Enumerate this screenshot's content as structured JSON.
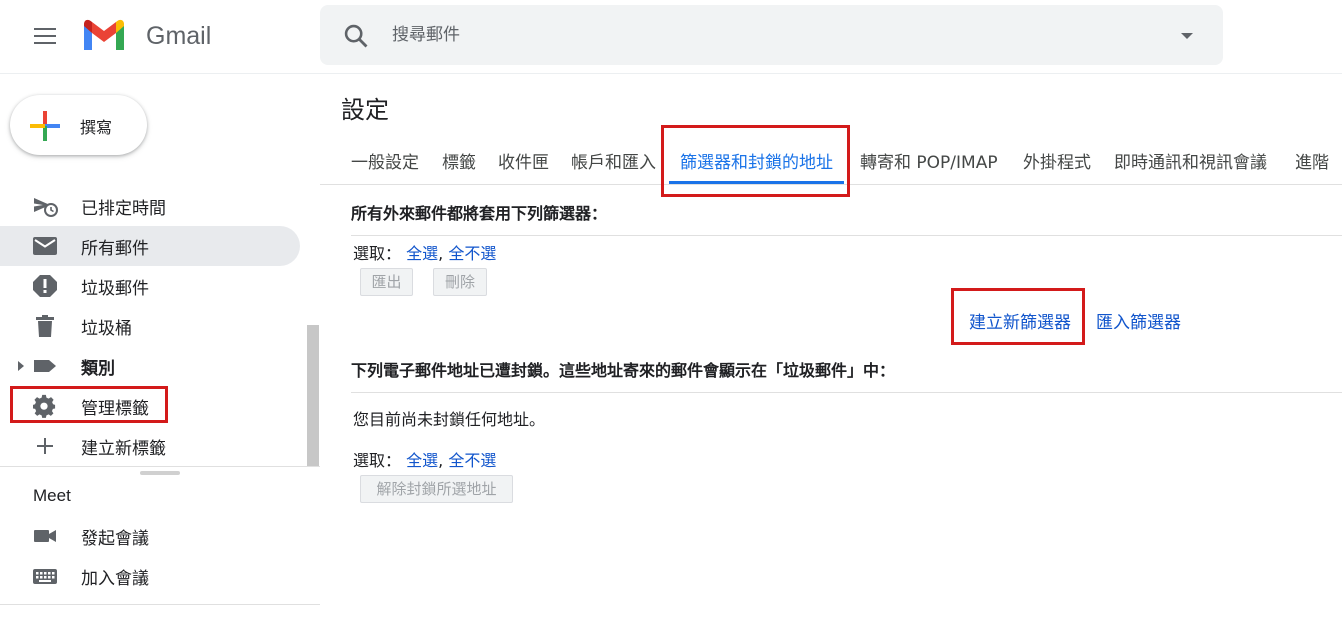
{
  "app": {
    "name": "Gmail",
    "brand_colors": {
      "red": "#ea4335",
      "blue": "#4285f4",
      "yellow": "#fbbc04",
      "green": "#34a853",
      "link": "#1155cc",
      "accent": "#1a73e8",
      "highlight": "#d31a1a"
    }
  },
  "header": {
    "menu_icon": "hamburger-menu-icon",
    "logo_text": "Gmail",
    "search": {
      "placeholder": "搜尋郵件",
      "value": "",
      "icon": "search-icon",
      "options_icon": "caret-down-icon"
    }
  },
  "sidebar": {
    "compose_label": "撰寫",
    "items": [
      {
        "label": "已排定時間",
        "icon": "scheduled-send-icon",
        "active": false
      },
      {
        "label": "所有郵件",
        "icon": "mail-icon",
        "active": true
      },
      {
        "label": "垃圾郵件",
        "icon": "spam-icon",
        "active": false
      },
      {
        "label": "垃圾桶",
        "icon": "trash-icon",
        "active": false
      },
      {
        "label": "類別",
        "icon": "label-icon",
        "active": false,
        "bold": true,
        "expandable": true
      },
      {
        "label": "管理標籤",
        "icon": "gear-icon",
        "active": false,
        "highlighted": true
      },
      {
        "label": "建立新標籤",
        "icon": "plus-icon",
        "active": false
      }
    ],
    "meet": {
      "title": "Meet",
      "items": [
        {
          "label": "發起會議",
          "icon": "video-camera-icon"
        },
        {
          "label": "加入會議",
          "icon": "keyboard-icon"
        }
      ]
    }
  },
  "settings": {
    "title": "設定",
    "tabs": [
      {
        "label": "一般設定",
        "active": false
      },
      {
        "label": "標籤",
        "active": false
      },
      {
        "label": "收件匣",
        "active": false
      },
      {
        "label": "帳戶和匯入",
        "active": false
      },
      {
        "label": "篩選器和封鎖的地址",
        "active": true,
        "highlighted": true
      },
      {
        "label": "轉寄和 POP/IMAP",
        "active": false
      },
      {
        "label": "外掛程式",
        "active": false
      },
      {
        "label": "即時通訊和視訊會議",
        "active": false
      },
      {
        "label": "進階",
        "active": false
      }
    ],
    "filters": {
      "heading": "所有外來郵件都將套用下列篩選器：",
      "select_label": "選取：",
      "select_all": "全選",
      "separator": ",",
      "select_none": "全不選",
      "export_button": "匯出",
      "delete_button": "刪除",
      "create_filter_link": "建立新篩選器",
      "import_filters_link": "匯入篩選器"
    },
    "blocked": {
      "heading": "下列電子郵件地址已遭封鎖。這些地址寄來的郵件會顯示在「垃圾郵件」中：",
      "empty_note": "您目前尚未封鎖任何地址。",
      "select_label": "選取：",
      "select_all": "全選",
      "separator": ",",
      "select_none": "全不選",
      "unblock_button": "解除封鎖所選地址"
    }
  }
}
